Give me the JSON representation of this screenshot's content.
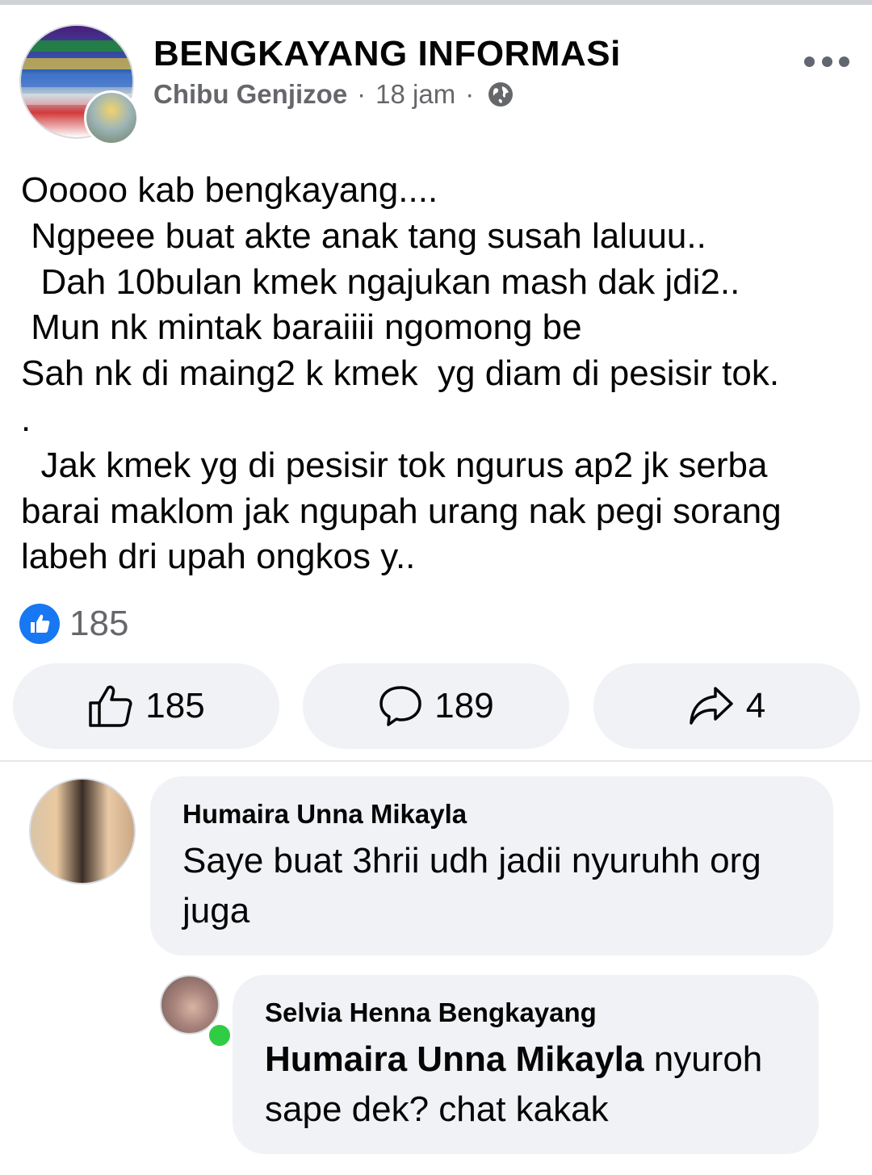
{
  "post": {
    "group_name": "BENGKAYANG INFORMASi",
    "author": "Chibu Genjizoe",
    "separator": "·",
    "time": "18 jam",
    "privacy_icon": "globe-icon",
    "menu_icon": "more-options-icon",
    "text": "Ooooo kab bengkayang....\n Ngpeee buat akte anak tang susah laluuu..\n  Dah 10bulan kmek ngajukan mash dak jdi2..\n Mun nk mintak baraiiii ngomong be\nSah nk di maing2 k kmek  yg diam di pesisir tok.\n.\n  Jak kmek yg di pesisir tok ngurus ap2 jk serba\nbarai maklom jak ngupah urang nak pegi sorang\nlabeh dri upah ongkos y.."
  },
  "reactions": {
    "icon": "like-reaction-icon",
    "count": "185"
  },
  "actions": {
    "like": {
      "icon": "thumbs-up-icon",
      "count": "185"
    },
    "comment": {
      "icon": "comment-icon",
      "count": "189"
    },
    "share": {
      "icon": "share-arrow-icon",
      "count": "4"
    }
  },
  "comments": [
    {
      "name": "Humaira Unna Mikayla",
      "text": "Saye buat 3hrii udh jadii nyuruhh org\njuga"
    }
  ],
  "replies": [
    {
      "name": "Selvia Henna Bengkayang",
      "mention": "Humaira Unna Mikayla",
      "text_line1_rest": " nyuroh",
      "text_line2": "sape dek? chat kakak",
      "online": true
    }
  ],
  "colors": {
    "brand_blue": "#1877f2",
    "secondary_text": "#65676b",
    "bubble_bg": "#f0f2f5",
    "online_green": "#31cc46"
  }
}
